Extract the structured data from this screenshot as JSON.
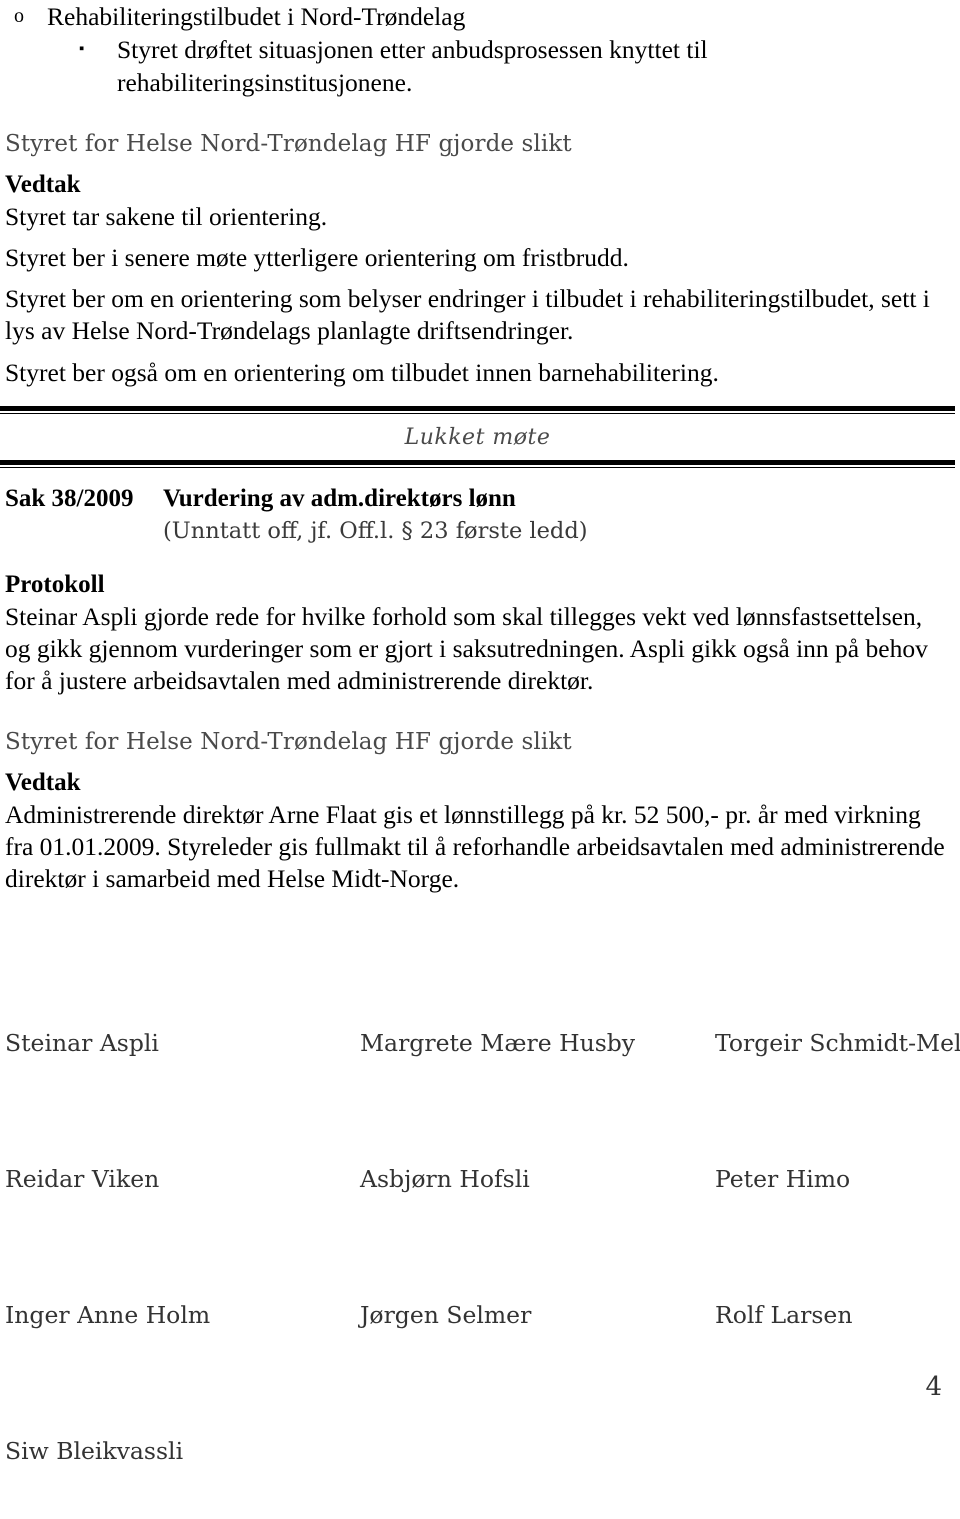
{
  "document": {
    "page_number": "4"
  },
  "bullets": {
    "level1_marker": "o",
    "level2_marker": "▪",
    "item1": "Rehabiliteringstilbudet i Nord-Trøndelag",
    "item1_sub_line1": "Styret drøftet situasjonen etter anbudsprosessen knyttet til",
    "item1_sub_line2": "rehabiliteringsinstitusjonene."
  },
  "decision_block_1": {
    "lead": "Styret for Helse Nord-Trøndelag HF gjorde slikt",
    "heading": "Vedtak",
    "paragraphs": [
      "Styret tar sakene til orientering.",
      "Styret ber i senere møte ytterligere orientering om fristbrudd.",
      "Styret ber om en orientering som belyser endringer i tilbudet i rehabiliteringstilbudet, sett i lys av Helse Nord-Trøndelags planlagte driftsendringer.",
      "Styret ber også om en orientering om tilbudet innen barnehabilitering."
    ]
  },
  "closed_meeting": {
    "label": "Lukket møte"
  },
  "case": {
    "number": "Sak 38/2009",
    "title": "Vurdering av adm.direktørs lønn",
    "subtitle": "(Unntatt off, jf. Off.l. § 23 første ledd)"
  },
  "protocol": {
    "heading": "Protokoll",
    "body": "Steinar Aspli gjorde rede for hvilke forhold som skal tillegges vekt ved lønnsfastsettelsen, og gikk gjennom vurderinger som er gjort i saksutredningen. Aspli gikk også inn på behov for å justere arbeidsavtalen med administrerende direktør."
  },
  "decision_block_2": {
    "lead": "Styret for Helse Nord-Trøndelag HF gjorde slikt",
    "heading": "Vedtak",
    "body": "Administrerende direktør Arne Flaat gis et lønnstillegg på kr. 52 500,- pr. år med virkning fra 01.01.2009. Styreleder gis fullmakt til å reforhandle arbeidsavtalen med administrerende direktør i samarbeid med Helse Midt-Norge."
  },
  "signatures": {
    "rows": [
      {
        "c1": "Steinar Aspli",
        "c2": "Margrete Mære Husby",
        "c3": "Torgeir Schmidt-Melbye"
      },
      {
        "c1": "Reidar Viken",
        "c2": "Asbjørn Hofsli",
        "c3": "Peter Himo"
      },
      {
        "c1": "Inger Anne Holm",
        "c2": "Jørgen Selmer",
        "c3": "Rolf Larsen"
      },
      {
        "c1": "Siw Bleikvassli",
        "c2": "",
        "c3": ""
      }
    ]
  }
}
